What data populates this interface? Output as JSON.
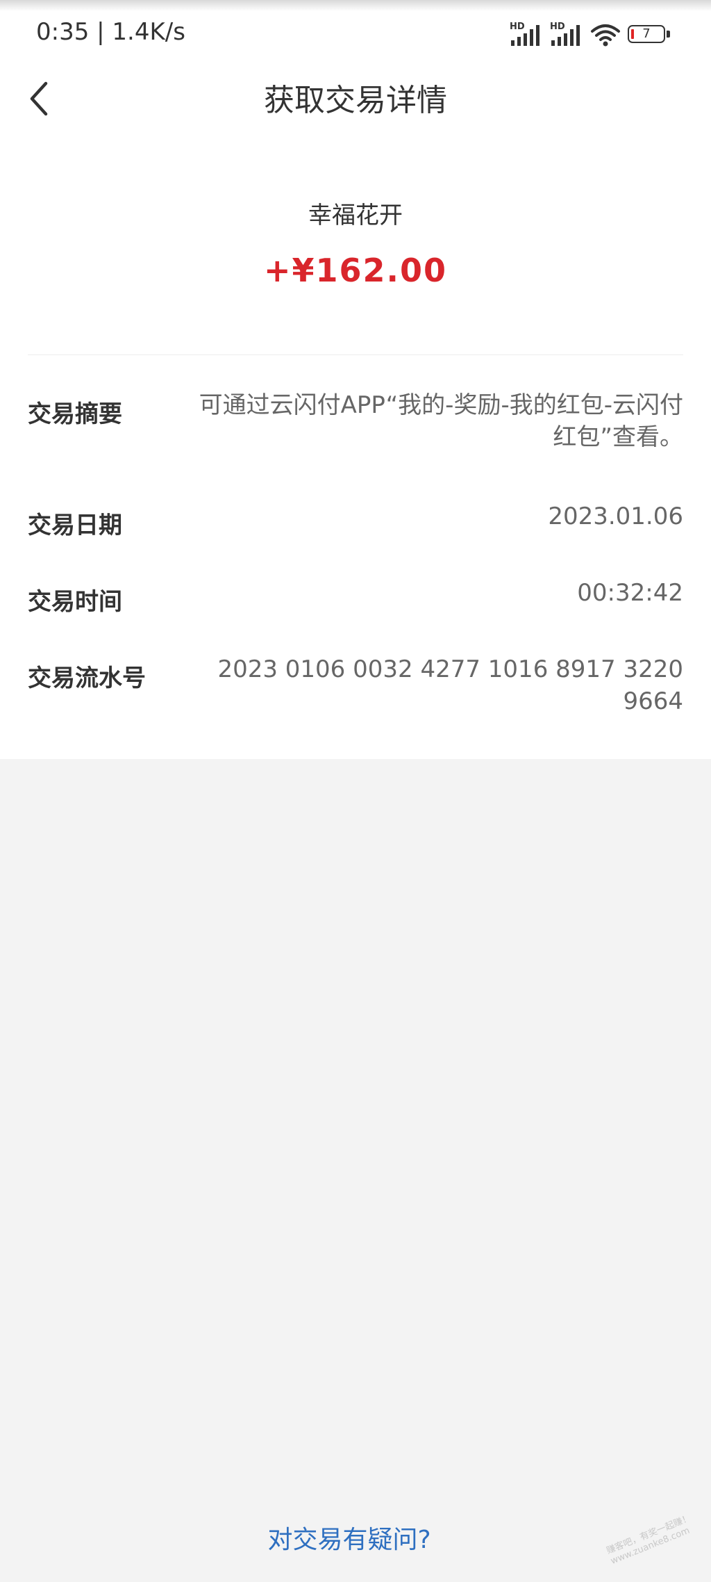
{
  "status_bar": {
    "time_speed": "0:35 | 1.4K/s",
    "hd_label_1": "HD",
    "hd_label_2": "HD",
    "battery": "7",
    "battery_color": "#e02424"
  },
  "header": {
    "title": "获取交易详情",
    "back_icon": "chevron-left-icon"
  },
  "summary": {
    "merchant": "幸福花开",
    "amount": "+¥162.00",
    "amount_color": "#d9252b"
  },
  "details": {
    "summary_label": "交易摘要",
    "summary_value": "可通过云闪付APP“我的-奖励-我的红包-云闪付红包”查看。",
    "date_label": "交易日期",
    "date_value": "2023.01.06",
    "time_label": "交易时间",
    "time_value": "00:32:42",
    "serial_label": "交易流水号",
    "serial_value": "2023 0106 0032 4277 1016 8917 3220 9664"
  },
  "footer": {
    "help_link": "对交易有疑问?",
    "link_color": "#2e6fc0",
    "watermark_line1": "赚客吧，有奖一起赚！",
    "watermark_line2": "www.zuanke8.com"
  }
}
